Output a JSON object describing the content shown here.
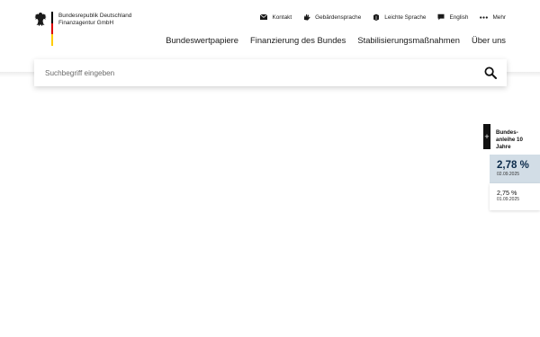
{
  "logo": {
    "line1": "Bundesrepublik Deutschland",
    "line2": "Finanzagentur GmbH",
    "emblem_icon": "federal-eagle-icon",
    "flag_colors": [
      "#000000",
      "#dd0000",
      "#ffcc00"
    ]
  },
  "service_nav": [
    {
      "label": "Kontakt",
      "icon": "envelope-icon"
    },
    {
      "label": "Gebärdensprache",
      "icon": "sign-language-icon"
    },
    {
      "label": "Leichte Sprache",
      "icon": "easy-language-icon"
    },
    {
      "label": "English",
      "icon": "speech-bubble-icon"
    },
    {
      "label": "Mehr",
      "icon": "more-dots-icon"
    }
  ],
  "main_nav": [
    {
      "label": "Bundeswertpapiere"
    },
    {
      "label": "Finanzierung des Bundes"
    },
    {
      "label": "Stabilisierungsmaßnahmen"
    },
    {
      "label": "Über uns"
    }
  ],
  "search": {
    "placeholder": "Suchbegriff eingeben",
    "value": "",
    "icon": "search-icon"
  },
  "rate_widget": {
    "toggle_label": "+",
    "title_line1": "Bundes-",
    "title_line2": "anleihe 10",
    "title_line3": "Jahre",
    "current": {
      "rate": "2,78 %",
      "date": "02.09.2025"
    },
    "previous": {
      "rate": "2,75 %",
      "date": "01.09.2025"
    },
    "accent_color": "#d2dde6",
    "text_color": "#0c2b4b"
  }
}
